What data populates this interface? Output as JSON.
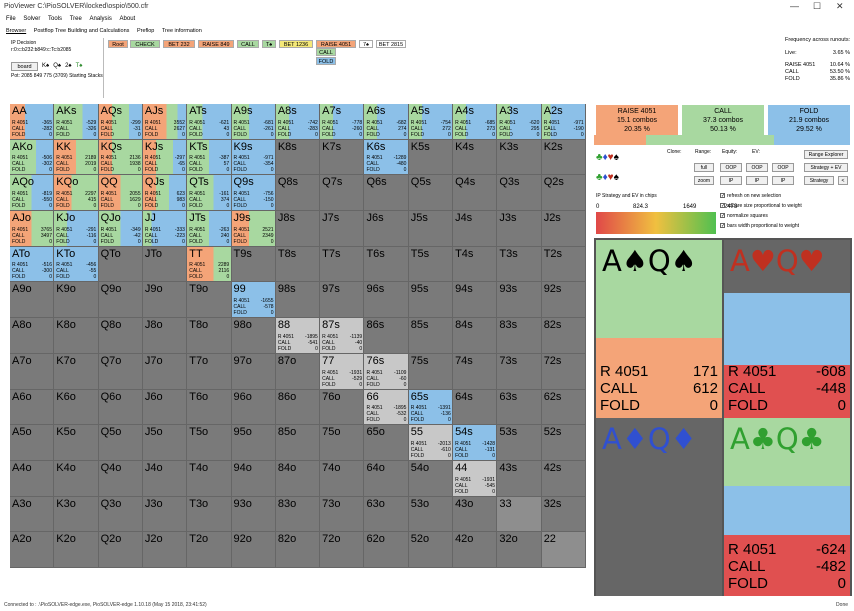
{
  "window": {
    "title": "PioViewer C:\\PioSOLVER\\locked\\ospio\\500.cfr",
    "minimize": "—",
    "maximize": "☐",
    "close": "✕"
  },
  "menu": [
    "File",
    "Solver",
    "Tools",
    "Tree",
    "Analysis",
    "About"
  ],
  "tabs": [
    "Browser",
    "Postflop Tree Building and Calculations",
    "Preflop",
    "Tree information"
  ],
  "decision": {
    "label": "IP Decision",
    "line": "r:0:c:b232:b849:c:Tc:b2085",
    "board_button": "board",
    "cards": [
      {
        "r": "K",
        "s": "♠",
        "c": "#000"
      },
      {
        "r": "Q",
        "s": "♠",
        "c": "#000"
      },
      {
        "r": "2",
        "s": "♠",
        "c": "#000"
      },
      {
        "r": "T",
        "s": "♠",
        "c": "#2a8a2a"
      }
    ],
    "pot": "Pot: 2085 849 775 (3709) Starting Stacks:"
  },
  "tree": [
    {
      "label": "Root",
      "bg": "#f4a478"
    },
    {
      "label": "CHECK",
      "bg": "#a8d8a0"
    },
    {
      "label": "BET 232",
      "bg": "#f4a478"
    },
    {
      "label": "RAISE 849",
      "bg": "#f4a478"
    },
    {
      "label": "CALL",
      "bg": "#a8d8a0"
    },
    {
      "label": "T♠",
      "bg": "#a8d8a0"
    },
    {
      "label": "BET 1236",
      "bg": "#f4e878"
    },
    {
      "label": "RAISE 4051",
      "bg": "#f4a478"
    },
    {
      "label": "7♠",
      "bg": "#ffffff"
    },
    {
      "label": "BET 2815",
      "bg": "#ffffff"
    },
    {
      "label": "CALL",
      "bg": "#a8d8a0"
    },
    {
      "label": "FOLD",
      "bg": "#8cc0e8"
    }
  ],
  "frequency": {
    "title": "Frequency across runouts:",
    "live_label": "Live:",
    "live": "3.65 %",
    "rows": [
      {
        "label": "RAISE 4051",
        "value": "10.64 %"
      },
      {
        "label": "CALL",
        "value": "53.50 %"
      },
      {
        "label": "FOLD",
        "value": "35.86 %"
      }
    ]
  },
  "summary": [
    {
      "label": "RAISE 4051",
      "combos": "15.1 combos",
      "pct": "20.35 %",
      "bg": "#f4a478",
      "frac": 0.2035
    },
    {
      "label": "CALL",
      "combos": "37.3 combos",
      "pct": "50.13 %",
      "bg": "#a8d8a0",
      "frac": 0.5013
    },
    {
      "label": "FOLD",
      "combos": "21.9 combos",
      "pct": "29.52 %",
      "bg": "#8cc0e8",
      "frac": 0.2952
    }
  ],
  "controls": {
    "clone": "Clone:",
    "range": "Range:",
    "equity": "Equity:",
    "ev": "EV:",
    "full": "full",
    "zoom": "zoom",
    "oop1": "OOP",
    "ip1": "IP",
    "oop2": "OOP",
    "ip2": "IP",
    "oop3": "OOP",
    "ip3": "IP",
    "range_explorer": "Range Explorer",
    "strategy_ev": "Strategy + EV",
    "strategy": "Strategy",
    "arrow": "<",
    "ev_title": "IP Strategy and EV in chips",
    "ev_min": "0",
    "ev_q1": "824.3",
    "ev_mid": "1649",
    "ev_max": "2473"
  },
  "checkboxes": [
    {
      "label": "refresh on new selection",
      "checked": true
    },
    {
      "label": "square size proportional to weight",
      "checked": true
    },
    {
      "label": "normalize squares",
      "checked": true
    },
    {
      "label": "bars width proportional to weight",
      "checked": true
    }
  ],
  "grid": [
    [
      "AA",
      "AKs",
      "AQs",
      "AJs",
      "ATs",
      "A9s",
      "A8s",
      "A7s",
      "A6s",
      "A5s",
      "A4s",
      "A3s",
      "A2s"
    ],
    [
      "AKo",
      "KK",
      "KQs",
      "KJs",
      "KTs",
      "K9s",
      "K8s",
      "K7s",
      "K6s",
      "K5s",
      "K4s",
      "K3s",
      "K2s"
    ],
    [
      "AQo",
      "KQo",
      "QQ",
      "QJs",
      "QTs",
      "Q9s",
      "Q8s",
      "Q7s",
      "Q6s",
      "Q5s",
      "Q4s",
      "Q3s",
      "Q2s"
    ],
    [
      "AJo",
      "KJo",
      "QJo",
      "JJ",
      "JTs",
      "J9s",
      "J8s",
      "J7s",
      "J6s",
      "J5s",
      "J4s",
      "J3s",
      "J2s"
    ],
    [
      "ATo",
      "KTo",
      "QTo",
      "JTo",
      "TT",
      "T9s",
      "T8s",
      "T7s",
      "T6s",
      "T5s",
      "T4s",
      "T3s",
      "T2s"
    ],
    [
      "A9o",
      "K9o",
      "Q9o",
      "J9o",
      "T9o",
      "99",
      "98s",
      "97s",
      "96s",
      "95s",
      "94s",
      "93s",
      "92s"
    ],
    [
      "A8o",
      "K8o",
      "Q8o",
      "J8o",
      "T8o",
      "98o",
      "88",
      "87s",
      "86s",
      "85s",
      "84s",
      "83s",
      "82s"
    ],
    [
      "A7o",
      "K7o",
      "Q7o",
      "J7o",
      "T7o",
      "97o",
      "87o",
      "77",
      "76s",
      "75s",
      "74s",
      "73s",
      "72s"
    ],
    [
      "A6o",
      "K6o",
      "Q6o",
      "J6o",
      "T6o",
      "96o",
      "86o",
      "76o",
      "66",
      "65s",
      "64s",
      "63s",
      "62s"
    ],
    [
      "A5o",
      "K5o",
      "Q5o",
      "J5o",
      "T5o",
      "95o",
      "85o",
      "75o",
      "65o",
      "55",
      "54s",
      "53s",
      "52s"
    ],
    [
      "A4o",
      "K4o",
      "Q4o",
      "J4o",
      "T4o",
      "94o",
      "84o",
      "74o",
      "64o",
      "54o",
      "44",
      "43s",
      "42s"
    ],
    [
      "A3o",
      "K3o",
      "Q3o",
      "J3o",
      "T3o",
      "93o",
      "83o",
      "73o",
      "63o",
      "53o",
      "43o",
      "33",
      "32s"
    ],
    [
      "A2o",
      "K2o",
      "Q2o",
      "J2o",
      "T2o",
      "92o",
      "82o",
      "72o",
      "62o",
      "52o",
      "42o",
      "32o",
      "22"
    ]
  ],
  "cells": {
    "AA": {
      "r": 0.35,
      "c": 0.0,
      "f": 0.65,
      "ev": [
        "-365",
        "-282",
        "0"
      ]
    },
    "AKs": {
      "r": 0.0,
      "c": 0.65,
      "f": 0.35,
      "ev": [
        "-529",
        "-326",
        "0"
      ]
    },
    "AQs": {
      "r": 0.3,
      "c": 0.4,
      "f": 0.3,
      "ev": [
        "-299",
        "-31",
        "0"
      ]
    },
    "AJs": {
      "r": 0.55,
      "c": 0.25,
      "f": 0.2,
      "ev": [
        "3552",
        "2627",
        "0"
      ]
    },
    "ATs": {
      "r": 0.0,
      "c": 0.35,
      "f": 0.65,
      "ev": [
        "-621",
        "43",
        "0"
      ]
    },
    "A9s": {
      "r": 0.0,
      "c": 0.4,
      "f": 0.6,
      "ev": [
        "-681",
        "-261",
        "0"
      ]
    },
    "A8s": {
      "r": 0.0,
      "c": 0.3,
      "f": 0.7,
      "ev": [
        "-742",
        "-283",
        "0"
      ]
    },
    "A7s": {
      "r": 0.0,
      "c": 0.3,
      "f": 0.7,
      "ev": [
        "-778",
        "-260",
        "0"
      ]
    },
    "A6s": {
      "r": 0.0,
      "c": 0.3,
      "f": 0.7,
      "ev": [
        "-682",
        "274",
        "0"
      ]
    },
    "A5s": {
      "r": 0.0,
      "c": 0.3,
      "f": 0.7,
      "ev": [
        "-754",
        "272",
        "0"
      ]
    },
    "A4s": {
      "r": 0.0,
      "c": 0.3,
      "f": 0.7,
      "ev": [
        "-685",
        "273",
        "0"
      ]
    },
    "A3s": {
      "r": 0.0,
      "c": 0.3,
      "f": 0.7,
      "ev": [
        "-620",
        "295",
        "0"
      ]
    },
    "A2s": {
      "r": 0.0,
      "c": 0.2,
      "f": 0.8,
      "ev": [
        "-971",
        "-190",
        "0"
      ]
    },
    "AKo": {
      "r": 0.0,
      "c": 0.6,
      "f": 0.4,
      "ev": [
        "-506",
        "-302",
        "0"
      ]
    },
    "KK": {
      "r": 0.5,
      "c": 0.5,
      "f": 0.0,
      "ev": [
        "2189",
        "2019",
        "0"
      ]
    },
    "KQs": {
      "r": 0.3,
      "c": 0.7,
      "f": 0.0,
      "ev": [
        "2136",
        "1938",
        "0"
      ]
    },
    "KJs": {
      "r": 0.3,
      "c": 0.4,
      "f": 0.3,
      "ev": [
        "-297",
        "-65",
        "0"
      ]
    },
    "KTs": {
      "r": 0.0,
      "c": 0.5,
      "f": 0.5,
      "ev": [
        "-387",
        "57",
        "0"
      ]
    },
    "K9s": {
      "r": 0.0,
      "c": 0.0,
      "f": 1.0,
      "ev": [
        "-971",
        "-354",
        "0"
      ]
    },
    "K6s": {
      "r": 0.0,
      "c": 0.0,
      "f": 1.0,
      "ev": [
        "-1289",
        "-480",
        "0"
      ]
    },
    "AQo": {
      "r": 0.0,
      "c": 0.5,
      "f": 0.5,
      "ev": [
        "-819",
        "-550",
        "0"
      ]
    },
    "KQo": {
      "r": 0.4,
      "c": 0.6,
      "f": 0.0,
      "ev": [
        "2297",
        "415",
        "0"
      ]
    },
    "QQ": {
      "r": 0.5,
      "c": 0.5,
      "f": 0.0,
      "ev": [
        "2055",
        "1629",
        "0"
      ]
    },
    "QJs": {
      "r": 0.3,
      "c": 0.3,
      "f": 0.4,
      "ev": [
        "623",
        "983",
        "0"
      ]
    },
    "QTs": {
      "r": 0.0,
      "c": 0.6,
      "f": 0.4,
      "ev": [
        "-161",
        "374",
        "0"
      ]
    },
    "Q9s": {
      "r": 0.0,
      "c": 0.0,
      "f": 1.0,
      "ev": [
        "-756",
        "-150",
        "0"
      ]
    },
    "AJo": {
      "r": 0.5,
      "c": 0.5,
      "f": 0.0,
      "ev": [
        "3765",
        "3497",
        "0"
      ]
    },
    "KJo": {
      "r": 0.0,
      "c": 0.3,
      "f": 0.7,
      "ev": [
        "-291",
        "-116",
        "0"
      ]
    },
    "QJo": {
      "r": 0.0,
      "c": 0.5,
      "f": 0.5,
      "ev": [
        "-349",
        "-42",
        "0"
      ]
    },
    "JJ": {
      "r": 0.0,
      "c": 0.2,
      "f": 0.8,
      "ev": [
        "-333",
        "-223",
        "0"
      ]
    },
    "JTs": {
      "r": 0.0,
      "c": 0.5,
      "f": 0.5,
      "ev": [
        "-263",
        "240",
        "0"
      ]
    },
    "J9s": {
      "r": 0.4,
      "c": 0.6,
      "f": 0.0,
      "ev": [
        "2521",
        "2349",
        "0"
      ]
    },
    "ATo": {
      "r": 0.0,
      "c": 0.0,
      "f": 1.0,
      "ev": [
        "-516",
        "-300",
        "0"
      ]
    },
    "KTo": {
      "r": 0.0,
      "c": 0.0,
      "f": 1.0,
      "ev": [
        "-456",
        "-55",
        "0"
      ]
    },
    "TT": {
      "r": 0.6,
      "c": 0.4,
      "f": 0.0,
      "ev": [
        "2289",
        "2116",
        "0"
      ]
    },
    "99": {
      "r": 0.0,
      "c": 0.0,
      "f": 1.0,
      "ev": [
        "-1655",
        "-578",
        "0"
      ]
    },
    "88": {
      "r": 0.0,
      "c": 0.0,
      "f": 0.0,
      "ev": [
        "-1895",
        "-541",
        "0"
      ]
    },
    "87s": {
      "r": 0.0,
      "c": 0.0,
      "f": 0.0,
      "ev": [
        "-1139",
        "-40",
        "0"
      ]
    },
    "77": {
      "r": 0.0,
      "c": 0.0,
      "f": 0.0,
      "ev": [
        "-1931",
        "-529",
        "0"
      ]
    },
    "76s": {
      "r": 0.0,
      "c": 0.0,
      "f": 0.0,
      "ev": [
        "-1109",
        "-60",
        "0"
      ]
    },
    "66": {
      "r": 0.0,
      "c": 0.0,
      "f": 0.0,
      "ev": [
        "-1895",
        "-532",
        "0"
      ]
    },
    "65s": {
      "r": 0.0,
      "c": 0.0,
      "f": 1.0,
      "ev": [
        "-1391",
        "-136",
        "0"
      ]
    },
    "55": {
      "r": 0.0,
      "c": 0.0,
      "f": 0.0,
      "ev": [
        "-2013",
        "-610",
        "0"
      ]
    },
    "54s": {
      "r": 0.0,
      "c": 0.0,
      "f": 1.0,
      "ev": [
        "-1428",
        "-131",
        "0"
      ]
    },
    "44": {
      "r": 0.0,
      "c": 0.0,
      "f": 0.0,
      "ev": [
        "-1931",
        "-545",
        "0"
      ]
    }
  },
  "ev_labels": [
    "R 4051",
    "CALL",
    "FOLD"
  ],
  "combos": [
    {
      "ranks": [
        "A",
        "Q"
      ],
      "suit": "♠",
      "color": "#000",
      "stats": [
        {
          "k": "R 4051",
          "v": "171"
        },
        {
          "k": "CALL",
          "v": "612"
        },
        {
          "k": "FOLD",
          "v": "0"
        }
      ],
      "segs": [
        {
          "c": "#a8d8a0",
          "h": 0.55
        },
        {
          "c": "#f4a478",
          "h": 0.45
        }
      ]
    },
    {
      "ranks": [
        "A",
        "Q"
      ],
      "suit": "♥",
      "color": "#c03020",
      "stats": [
        {
          "k": "R 4051",
          "v": "-608"
        },
        {
          "k": "CALL",
          "v": "-448"
        },
        {
          "k": "FOLD",
          "v": "0"
        }
      ],
      "segs": [
        {
          "c": "#666",
          "h": 0.3
        },
        {
          "c": "#8cc0e8",
          "h": 0.4
        },
        {
          "c": "#e05050",
          "h": 0.3
        }
      ]
    },
    {
      "ranks": [
        "A",
        "Q"
      ],
      "suit": "♦",
      "color": "#3050d0",
      "stats": [],
      "segs": [
        {
          "c": "#666",
          "h": 1.0
        }
      ]
    },
    {
      "ranks": [
        "A",
        "Q"
      ],
      "suit": "♣",
      "color": "#30a030",
      "stats": [
        {
          "k": "R 4051",
          "v": "-624"
        },
        {
          "k": "CALL",
          "v": "-482"
        },
        {
          "k": "FOLD",
          "v": "0"
        }
      ],
      "segs": [
        {
          "c": "#a8d8a0",
          "h": 0.38
        },
        {
          "c": "#8cc0e8",
          "h": 0.28
        },
        {
          "c": "#e05050",
          "h": 0.34
        }
      ]
    }
  ],
  "status": {
    "left": "Connected to : .\\PioSOLVER-edge.exe, PioSOLVER-edge 1.10.18 (May 15 2018, 23:41:52)",
    "right": "Done"
  }
}
